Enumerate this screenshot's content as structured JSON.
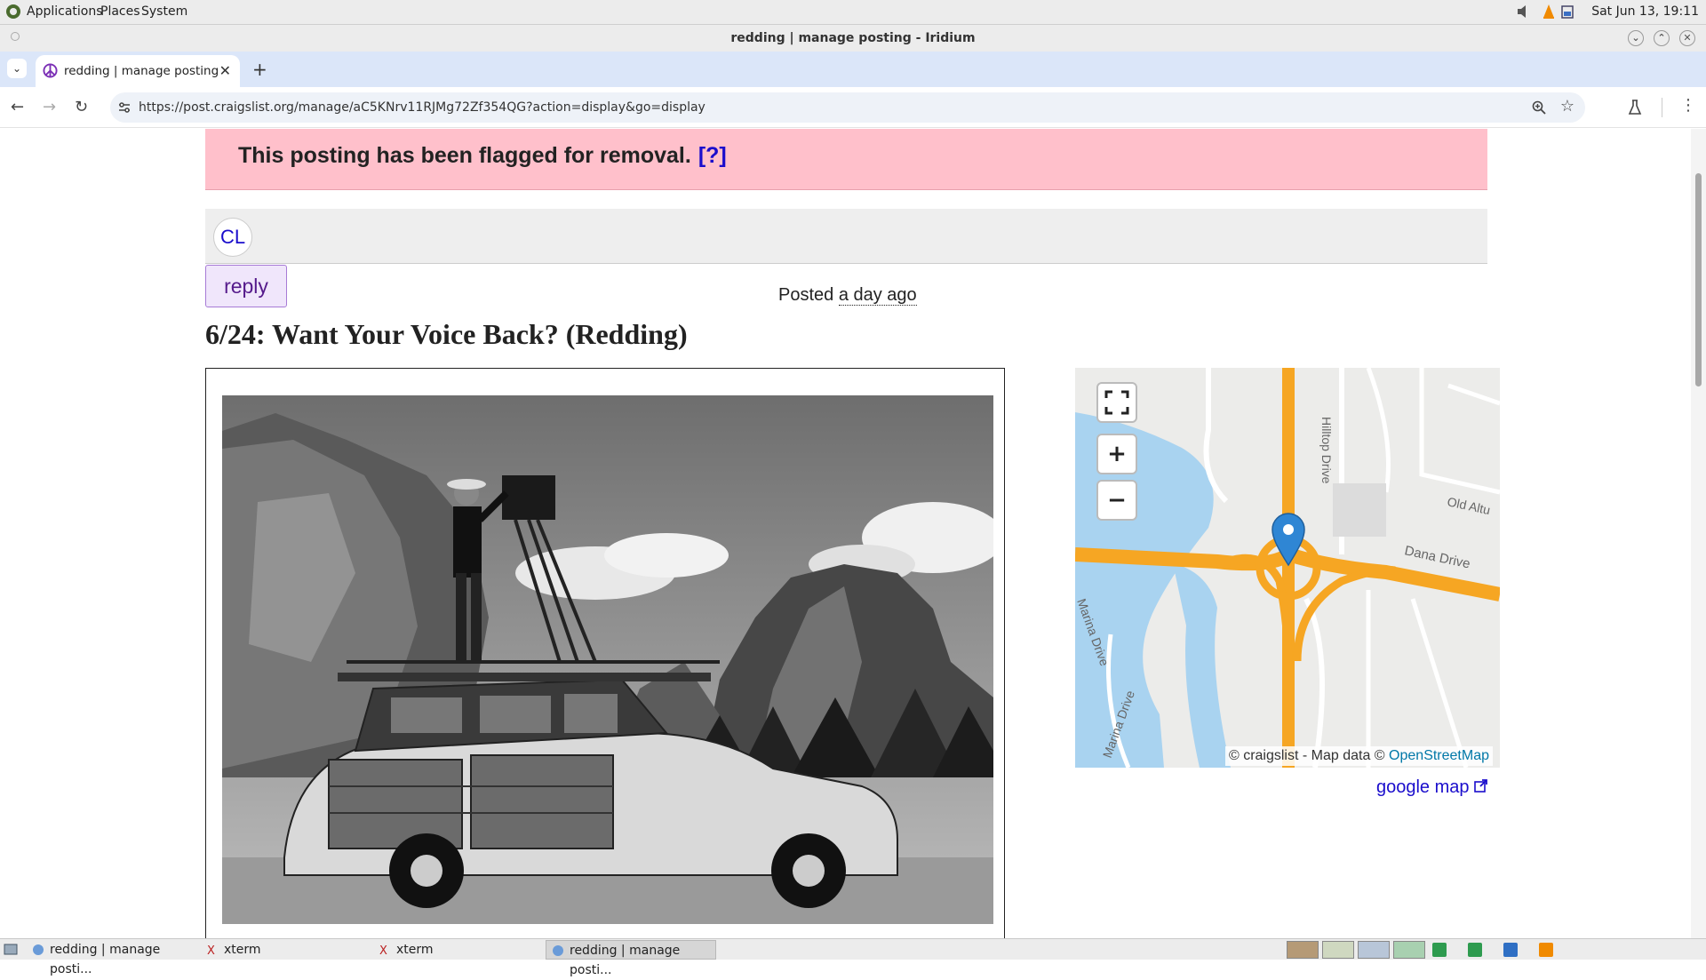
{
  "system": {
    "menus": [
      "Applications",
      "Places",
      "System"
    ],
    "clock": "Sat Jun 13, 19:11"
  },
  "window": {
    "title": "redding | manage posting - Iridium"
  },
  "browser": {
    "tab_title": "redding | manage posting",
    "url": "https://post.craigslist.org/manage/aC5KNrv11RJMg72Zf354QG?action=display&go=display"
  },
  "page": {
    "flag_message": "This posting has been flagged for removal.",
    "flag_help": "[?]",
    "logo": "CL",
    "reply_label": "reply",
    "posted_prefix": "Posted",
    "posted_time": "a day ago",
    "title": "6/24: Want Your Voice Back? (Redding)",
    "map": {
      "attribution_prefix": "© craigslist - Map data ©",
      "attribution_link": "OpenStreetMap",
      "road_labels": [
        "Hilltop Drive",
        "Old Altu",
        "Dana Drive",
        "Marina Drive",
        "Marina Drive"
      ],
      "fullscreen_icon": "fullscreen-icon",
      "zoom_in_label": "+",
      "zoom_out_label": "−"
    },
    "google_map_label": "google map"
  },
  "taskbar": {
    "items": [
      "redding | manage posti...",
      "xterm",
      "xterm",
      "redding | manage posti..."
    ]
  },
  "colors": {
    "flag_bg": "#ffc0cb",
    "link": "#1a0dcc",
    "map_road": "#f6a623",
    "map_water": "#a9d3f0",
    "pin": "#2f86d4"
  }
}
